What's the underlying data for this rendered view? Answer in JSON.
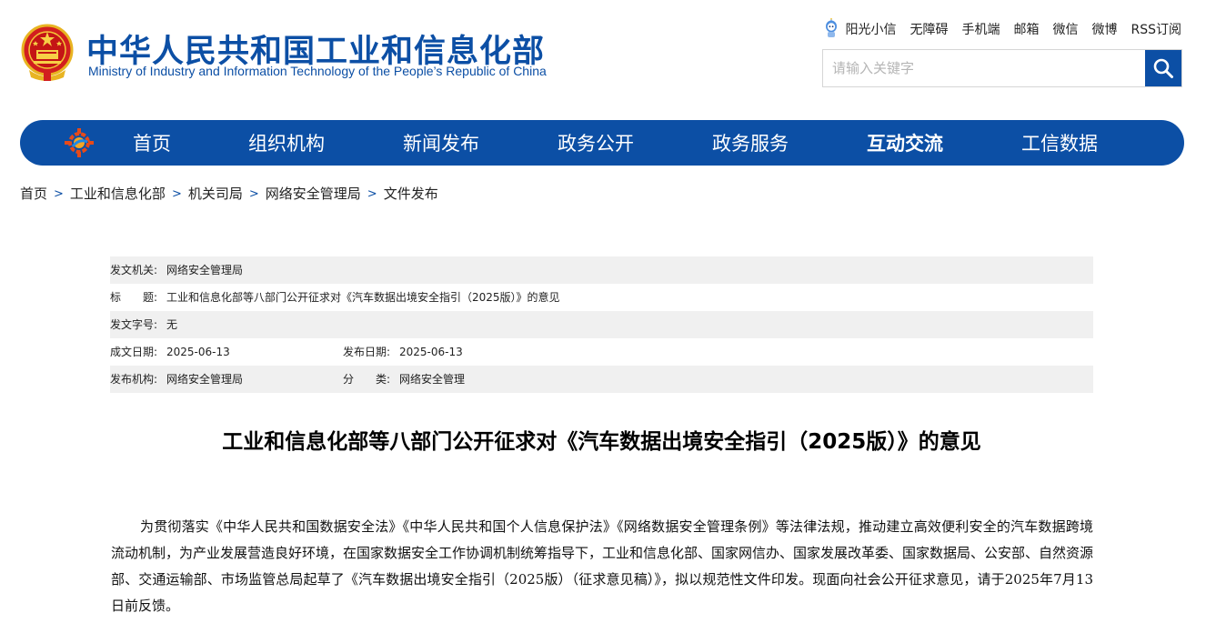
{
  "header": {
    "title_cn": "中华人民共和国工业和信息化部",
    "title_en": "Ministry of Industry and Information Technology of the People’s Republic of China",
    "emblem_icon": "national-emblem-icon"
  },
  "top_links": [
    "阳光小信",
    "无障碍",
    "手机端",
    "邮箱",
    "微信",
    "微博",
    "RSS订阅"
  ],
  "search": {
    "placeholder": "请输入关键字",
    "value": ""
  },
  "nav": {
    "items": [
      "首页",
      "组织机构",
      "新闻发布",
      "政务公开",
      "政务服务",
      "互动交流",
      "工信数据"
    ],
    "active": "互动交流"
  },
  "breadcrumb": {
    "items": [
      "首页",
      "工业和信息化部",
      "机关司局",
      "网络安全管理局",
      "文件发布"
    ],
    "separator": ">"
  },
  "meta": {
    "issuer_label": "发文机关:",
    "issuer": "网络安全管理局",
    "title_label": "标　　题:",
    "title": "工业和信息化部等八部门公开征求对《汽车数据出境安全指引（2025版）》的意见",
    "doc_no_label": "发文字号:",
    "doc_no": "无",
    "created_label": "成文日期:",
    "created": "2025-06-13",
    "published_label": "发布日期:",
    "published": "2025-06-13",
    "publisher_label": "发布机构:",
    "publisher": "网络安全管理局",
    "category_label": "分　　类:",
    "category": "网络安全管理"
  },
  "article": {
    "title": "工业和信息化部等八部门公开征求对《汽车数据出境安全指引（2025版）》的意见",
    "paragraph": "为贯彻落实《中华人民共和国数据安全法》《中华人民共和国个人信息保护法》《网络数据安全管理条例》等法律法规，推动建立高效便利安全的汽车数据跨境流动机制，为产业发展营造良好环境，在国家数据安全工作协调机制统筹指导下，工业和信息化部、国家网信办、国家发展改革委、国家数据局、公安部、自然资源部、交通运输部、市场监管总局起草了《汽车数据出境安全指引（2025版）（征求意见稿）》，拟以规范性文件印发。现面向社会公开征求意见，请于2025年7月13日前反馈。"
  },
  "colors": {
    "brand": "#0c4fa5",
    "meta_grey": "#f0f0f0"
  }
}
